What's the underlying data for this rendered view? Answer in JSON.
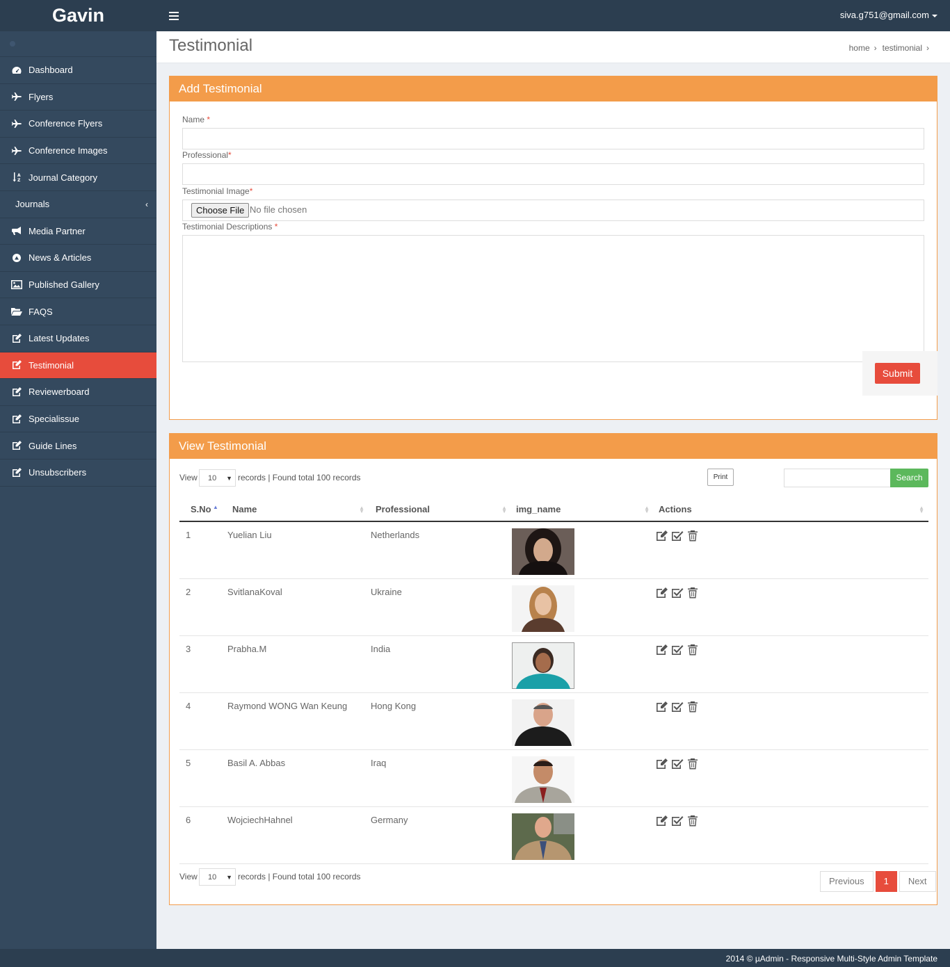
{
  "brand": "Gavin",
  "user_email": "siva.g751@gmail.com",
  "sidebar": {
    "items": [
      {
        "label": "Dashboard",
        "icon": "dashboard-icon"
      },
      {
        "label": "Flyers",
        "icon": "plane-icon"
      },
      {
        "label": "Conference Flyers",
        "icon": "plane-icon"
      },
      {
        "label": "Conference Images",
        "icon": "plane-icon"
      },
      {
        "label": "Journal Category",
        "icon": "sort-alpha-icon"
      },
      {
        "label": "Journals",
        "icon": ""
      },
      {
        "label": "Media Partner",
        "icon": "bullhorn-icon"
      },
      {
        "label": "News & Articles",
        "icon": "circle-icon"
      },
      {
        "label": "Published Gallery",
        "icon": "picture-icon"
      },
      {
        "label": "FAQS",
        "icon": "folder-open-icon"
      },
      {
        "label": "Latest Updates",
        "icon": "edit-icon"
      },
      {
        "label": "Testimonial",
        "icon": "edit-icon"
      },
      {
        "label": "Reviewerboard",
        "icon": "edit-icon"
      },
      {
        "label": "Specialissue",
        "icon": "edit-icon"
      },
      {
        "label": "Guide Lines",
        "icon": "edit-icon"
      },
      {
        "label": "Unsubscribers",
        "icon": "edit-icon"
      }
    ],
    "active": "Testimonial"
  },
  "page": {
    "title": "Testimonial",
    "breadcrumb": [
      "home",
      "testimonial"
    ]
  },
  "form": {
    "header": "Add Testimonial",
    "name_label": "Name",
    "name_value": "",
    "professional_label": "Professional",
    "professional_value": "",
    "image_label": "Testimonial Image",
    "choose_file": "Choose File",
    "no_file": "No file chosen",
    "desc_label": "Testimonial Descriptions",
    "desc_value": "",
    "required_mark": "*",
    "submit": "Submit"
  },
  "list": {
    "header": "View Testimonial",
    "view_label": "View",
    "page_size": "10",
    "records_text": "records | Found total 100 records",
    "print": "Print",
    "search_value": "",
    "search_button": "Search",
    "columns": [
      "S.No",
      "Name",
      "Professional",
      "img_name",
      "Actions"
    ],
    "rows": [
      {
        "sno": "1",
        "name": "Yuelian Liu",
        "professional": "Netherlands"
      },
      {
        "sno": "2",
        "name": "SvitlanaKoval",
        "professional": "Ukraine"
      },
      {
        "sno": "3",
        "name": "Prabha.M",
        "professional": "India"
      },
      {
        "sno": "4",
        "name": "Raymond WONG Wan Keung",
        "professional": "Hong Kong"
      },
      {
        "sno": "5",
        "name": "Basil A. Abbas",
        "professional": "Iraq"
      },
      {
        "sno": "6",
        "name": "WojciechHahnel",
        "professional": "Germany"
      }
    ],
    "pager": {
      "previous": "Previous",
      "current": "1",
      "next": "Next"
    }
  },
  "footer": "2014 © µAdmin - Responsive Multi-Style Admin Template",
  "colors": {
    "sidebar": "#34495e",
    "topbar": "#2c3e50",
    "accent_orange": "#f39c4a",
    "active_red": "#e74c3c",
    "search_green": "#5cb85c"
  }
}
